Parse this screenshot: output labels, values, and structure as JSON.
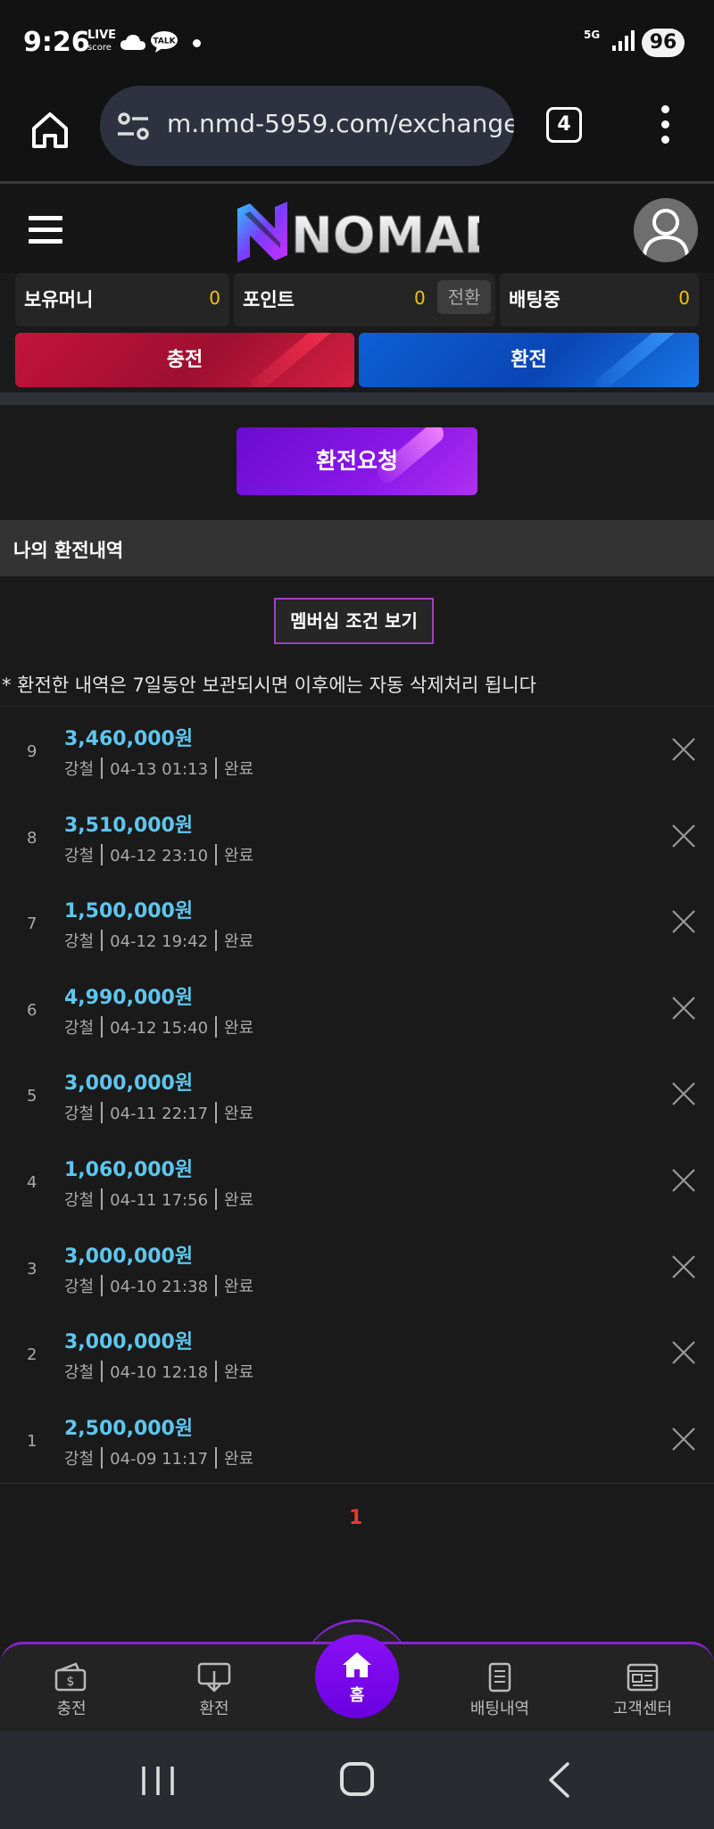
{
  "status_bar": {
    "time": "9:26",
    "live_score_top": "LIVE",
    "live_score_bottom": "score",
    "talk_badge": "TALK",
    "network": "5G",
    "battery": "96",
    "icons": [
      "live-score-icon",
      "cloud-icon",
      "talk-icon",
      "notification-dot",
      "5g-icon",
      "signal-icon",
      "battery-icon"
    ]
  },
  "browser": {
    "url": "m.nmd-5959.com/exchange",
    "tab_count": "4",
    "icons": [
      "home-icon",
      "site-settings-icon",
      "more-vert-icon"
    ]
  },
  "header": {
    "logo_text": "NOMAD",
    "icons": [
      "hamburger-menu-icon",
      "user-avatar-icon"
    ]
  },
  "balances": {
    "money_label": "보유머니",
    "money_value": "0",
    "points_label": "포인트",
    "points_value": "0",
    "convert_label": "전환",
    "betting_label": "배팅중",
    "betting_value": "0"
  },
  "actions": {
    "charge_label": "충전",
    "exchange_label": "환전"
  },
  "request": {
    "label": "환전요청"
  },
  "history": {
    "title": "나의 환전내역",
    "membership_label": "멤버십 조건 보기",
    "note": "* 환전한 내역은 7일동안 보관되시면 이후에는 자동 삭제처리 됩니다",
    "rows": [
      {
        "index": "9",
        "amount": "3,460,000원",
        "bank": "강철",
        "datetime": "04-13 01:13",
        "status": "완료"
      },
      {
        "index": "8",
        "amount": "3,510,000원",
        "bank": "강철",
        "datetime": "04-12 23:10",
        "status": "완료"
      },
      {
        "index": "7",
        "amount": "1,500,000원",
        "bank": "강철",
        "datetime": "04-12 19:42",
        "status": "완료"
      },
      {
        "index": "6",
        "amount": "4,990,000원",
        "bank": "강철",
        "datetime": "04-12 15:40",
        "status": "완료"
      },
      {
        "index": "5",
        "amount": "3,000,000원",
        "bank": "강철",
        "datetime": "04-11 22:17",
        "status": "완료"
      },
      {
        "index": "4",
        "amount": "1,060,000원",
        "bank": "강철",
        "datetime": "04-11 17:56",
        "status": "완료"
      },
      {
        "index": "3",
        "amount": "3,000,000원",
        "bank": "강철",
        "datetime": "04-10 21:38",
        "status": "완료"
      },
      {
        "index": "2",
        "amount": "3,000,000원",
        "bank": "강철",
        "datetime": "04-10 12:18",
        "status": "완료"
      },
      {
        "index": "1",
        "amount": "2,500,000원",
        "bank": "강철",
        "datetime": "04-09 11:17",
        "status": "완료"
      }
    ],
    "current_page": "1"
  },
  "bottom_nav": {
    "items": [
      {
        "label": "충전",
        "icon": "wallet-icon"
      },
      {
        "label": "환전",
        "icon": "exchange-icon"
      },
      {
        "label": "홈",
        "icon": "home-icon"
      },
      {
        "label": "배팅내역",
        "icon": "document-icon"
      },
      {
        "label": "고객센터",
        "icon": "newspaper-icon"
      }
    ]
  },
  "colors": {
    "background": "#1a1a1a",
    "accent_purple": "#8a18e8",
    "amount_blue": "#5ec6ee",
    "balance_yellow": "#f4c400",
    "charge_red": "#c2143a",
    "exchange_blue": "#0d5fd6",
    "page_red": "#e53935"
  }
}
